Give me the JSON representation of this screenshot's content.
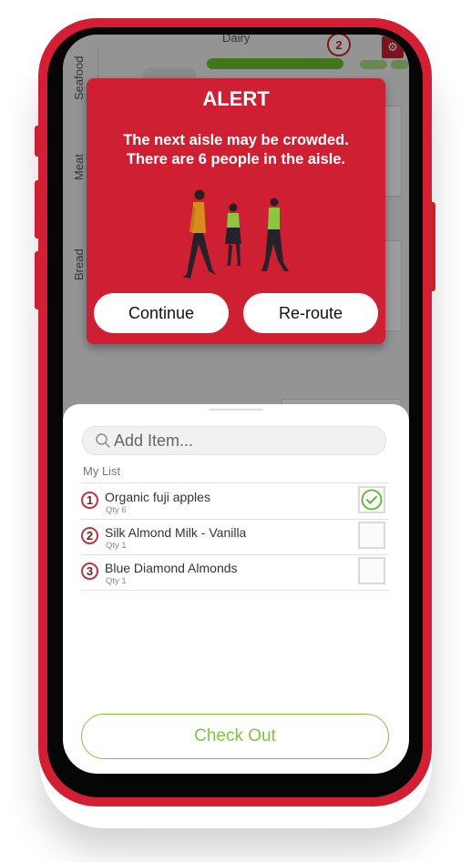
{
  "map": {
    "aisles": [
      "Seafood",
      "Meat",
      "Bread",
      "Dairy"
    ],
    "marker_number": "2",
    "settings_icon": "gear-icon"
  },
  "alert": {
    "title": "ALERT",
    "message_line1": "The next aisle may be crowded.",
    "message_line2": "There are 6 people in the aisle.",
    "continue_label": "Continue",
    "reroute_label": "Re-route"
  },
  "sheet": {
    "search_placeholder": "Add Item...",
    "search_icon": "search-icon",
    "list_title": "My List",
    "items": [
      {
        "number": "1",
        "name": "Organic fuji apples",
        "qty": "Qty 6",
        "checked": true
      },
      {
        "number": "2",
        "name": "Silk Almond Milk - Vanilla",
        "qty": "Qty 1",
        "checked": false
      },
      {
        "number": "3",
        "name": "Blue Diamond Almonds",
        "qty": "Qty 1",
        "checked": false
      }
    ],
    "checkout_label": "Check Out"
  },
  "colors": {
    "brand_red": "#ce2032",
    "accent_green": "#7cc83a",
    "route_green": "#66c12a"
  }
}
